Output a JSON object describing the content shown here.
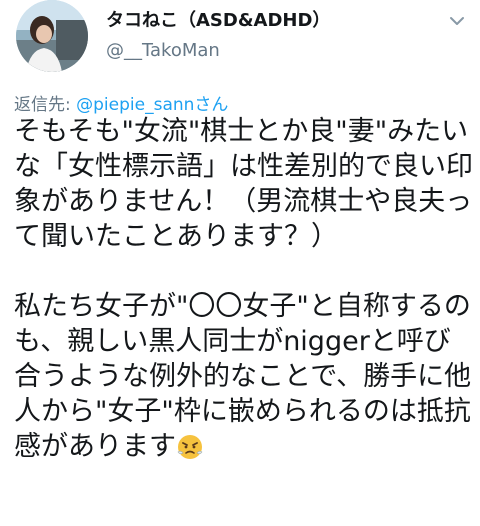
{
  "tweet": {
    "display_name": "タコねこ（ASD&ADHD）",
    "handle": "@__TakoMan",
    "reply_prefix": "返信先: ",
    "reply_mention": "@piepie_sannさん",
    "paragraph_1": "そもそも\"女流\"棋士とか良\"妻\"みたいな「女性標示語」は性差別的で良い印象がありません！（男流棋士や良夫って聞いたことあります？）",
    "paragraph_2": "私たち女子が\"〇〇女子\"と自称するのも、親しい黒人同士がniggerと呼び合うような例外的なことで、勝手に他人から\"女子\"枠に嵌められるのは抵抗感があります",
    "emoji_icon": "angry-steam-face-icon",
    "more_icon": "chevron-down-icon"
  },
  "colors": {
    "text": "#14171a",
    "secondary": "#657786",
    "link": "#1da1f2"
  }
}
